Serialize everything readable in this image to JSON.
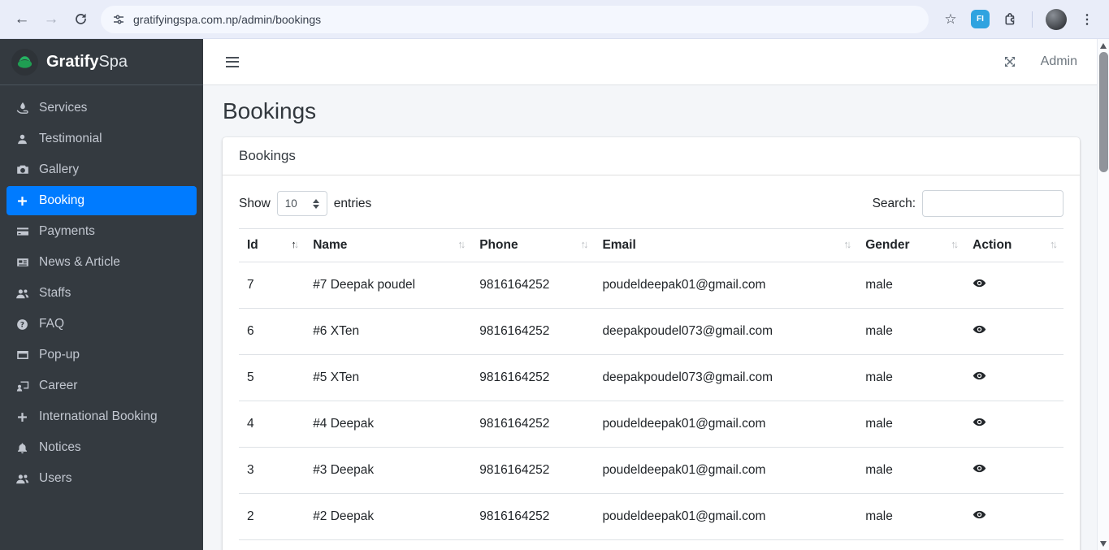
{
  "browser": {
    "url": "gratifyingspa.com.np/admin/bookings",
    "back_glyph": "←",
    "forward_glyph": "→",
    "star_glyph": "☆",
    "menu_glyph": "⋮",
    "extension_badge": "FI"
  },
  "sidebar": {
    "brand": {
      "name_bold": "Gratify",
      "name_light": "Spa"
    },
    "items": [
      {
        "label": "Services",
        "icon": "hand-holding-water-icon",
        "active": false
      },
      {
        "label": "Testimonial",
        "icon": "user-icon",
        "active": false
      },
      {
        "label": "Gallery",
        "icon": "camera-icon",
        "active": false
      },
      {
        "label": "Booking",
        "icon": "plus-icon",
        "active": true
      },
      {
        "label": "Payments",
        "icon": "credit-card-icon",
        "active": false
      },
      {
        "label": "News & Article",
        "icon": "newspaper-icon",
        "active": false
      },
      {
        "label": "Staffs",
        "icon": "users-icon",
        "active": false
      },
      {
        "label": "FAQ",
        "icon": "question-circle-icon",
        "active": false
      },
      {
        "label": "Pop-up",
        "icon": "window-icon",
        "active": false
      },
      {
        "label": "Career",
        "icon": "chalkboard-user-icon",
        "active": false
      },
      {
        "label": "International Booking",
        "icon": "plus-icon",
        "active": false
      },
      {
        "label": "Notices",
        "icon": "bell-icon",
        "active": false
      },
      {
        "label": "Users",
        "icon": "users-icon",
        "active": false
      }
    ]
  },
  "topbar": {
    "user_label": "Admin"
  },
  "page": {
    "title": "Bookings"
  },
  "card": {
    "title": "Bookings",
    "show_label": "Show",
    "entries_label": "entries",
    "page_length": "10",
    "search_label": "Search:",
    "search_value": ""
  },
  "table": {
    "sort_up_glyph": "↑",
    "sort_down_glyph": "↓",
    "columns": [
      {
        "label": "Id",
        "sorted": "ascending"
      },
      {
        "label": "Name",
        "sorted": "none"
      },
      {
        "label": "Phone",
        "sorted": "none"
      },
      {
        "label": "Email",
        "sorted": "none"
      },
      {
        "label": "Gender",
        "sorted": "none"
      },
      {
        "label": "Action",
        "sorted": "none"
      }
    ],
    "rows": [
      {
        "id": "7",
        "name": "#7 Deepak poudel",
        "phone": "9816164252",
        "email": "poudeldeepak01@gmail.com",
        "gender": "male"
      },
      {
        "id": "6",
        "name": "#6 XTen",
        "phone": "9816164252",
        "email": "deepakpoudel073@gmail.com",
        "gender": "male"
      },
      {
        "id": "5",
        "name": "#5 XTen",
        "phone": "9816164252",
        "email": "deepakpoudel073@gmail.com",
        "gender": "male"
      },
      {
        "id": "4",
        "name": "#4 Deepak",
        "phone": "9816164252",
        "email": "poudeldeepak01@gmail.com",
        "gender": "male"
      },
      {
        "id": "3",
        "name": "#3 Deepak",
        "phone": "9816164252",
        "email": "poudeldeepak01@gmail.com",
        "gender": "male"
      },
      {
        "id": "2",
        "name": "#2 Deepak",
        "phone": "9816164252",
        "email": "poudeldeepak01@gmail.com",
        "gender": "male"
      }
    ]
  },
  "colors": {
    "accent": "#007bff",
    "sidebar_bg": "#343a40",
    "content_bg": "#f4f6f9",
    "brand_green": "#1f9e52",
    "extension_blue": "#2fa3e0"
  }
}
